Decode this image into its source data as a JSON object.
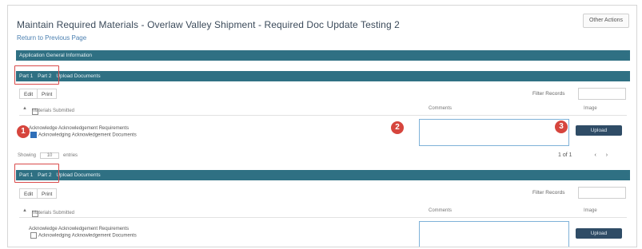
{
  "header": {
    "title": "Maintain Required Materials - Overlaw Valley Shipment - Required Doc Update Testing 2",
    "return_link": "Return to Previous Page",
    "top_button": "Other Actions"
  },
  "application_bar": {
    "label": "Application General Information"
  },
  "sections": [
    {
      "tabs": [
        "Part 1",
        "Part 2"
      ],
      "bar_label": "Upload Documents",
      "buttons": {
        "edit": "Edit",
        "print": "Print"
      },
      "filter_label": "Filter Records",
      "columns": {
        "material": "Materials Submitted",
        "comments": "Comments",
        "image": "Image"
      },
      "row_lines": [
        "Acknowledge Acknowledgement Requirements",
        "Acknowledging Acknowledgement Documents"
      ],
      "row_checked": true,
      "upload_label": "Upload",
      "footer": {
        "showing": "Showing",
        "per_page": "10",
        "entries": "entries",
        "page_info": "1 of 1"
      }
    },
    {
      "tabs": [
        "Part 1",
        "Part 2"
      ],
      "bar_label": "Upload Documents",
      "buttons": {
        "edit": "Edit",
        "print": "Print"
      },
      "filter_label": "Filter Records",
      "columns": {
        "material": "Materials Submitted",
        "comments": "Comments",
        "image": "Image"
      },
      "row_lines": [
        "Acknowledge Acknowledgement Requirements",
        "Acknowledging Acknowledgement Documents"
      ],
      "row_checked": false,
      "upload_label": "Upload"
    }
  ],
  "markers": [
    "1",
    "2",
    "3"
  ],
  "colors": {
    "bar": "#2f7083",
    "upload": "#2f4c66",
    "marker": "#d6453d",
    "highlight": "#d94a4a"
  }
}
